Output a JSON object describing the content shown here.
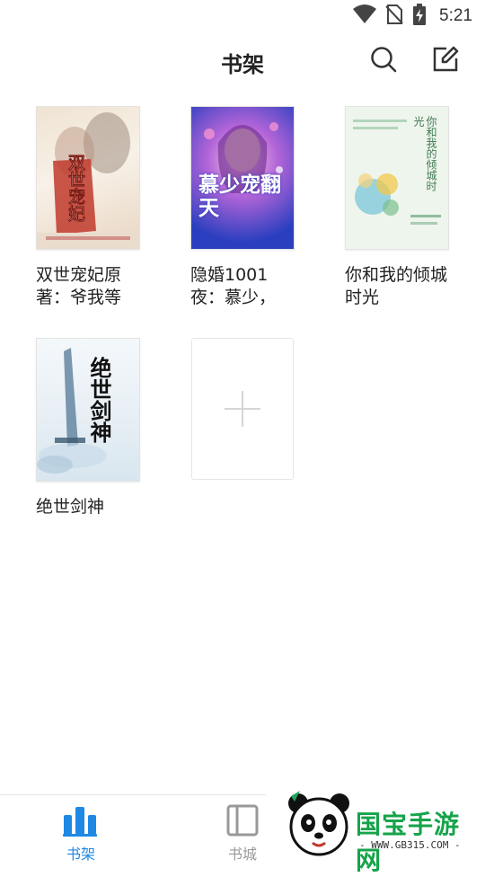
{
  "status_bar": {
    "time": "5:21",
    "icons": [
      "wifi-icon",
      "no-sim-icon",
      "battery-charging-icon"
    ]
  },
  "header": {
    "title": "书架",
    "actions": [
      "search-icon",
      "edit-icon"
    ]
  },
  "books": [
    {
      "title": "双世宠妃原著：爷我等",
      "cover_text": "双世宠妃",
      "cover_colors": [
        "#f6efe4",
        "#c0392b"
      ]
    },
    {
      "title": "隐婚1001夜：慕少，",
      "cover_text": "慕少宠翻天",
      "cover_colors": [
        "#2a3fbf",
        "#e64fa5"
      ]
    },
    {
      "title": "你和我的倾城时光",
      "cover_text": "你和我的倾城时光",
      "cover_colors": [
        "#f1f6ee",
        "#6aa37e"
      ]
    },
    {
      "title": "绝世剑神",
      "cover_text": "绝世剑神",
      "cover_colors": [
        "#eef4f8",
        "#222222"
      ]
    }
  ],
  "add_book": {
    "icon": "plus-icon"
  },
  "bottom_nav": {
    "items": [
      {
        "label": "书架",
        "icon": "bookshelf-icon",
        "active": true,
        "color": "#1e88e5"
      },
      {
        "label": "书城",
        "icon": "bookstore-icon",
        "active": false,
        "color": "#999999"
      }
    ]
  },
  "watermark": {
    "brand": "国宝手游网",
    "url": "- WWW.GB315.COM -",
    "icon": "panda-logo-icon"
  }
}
